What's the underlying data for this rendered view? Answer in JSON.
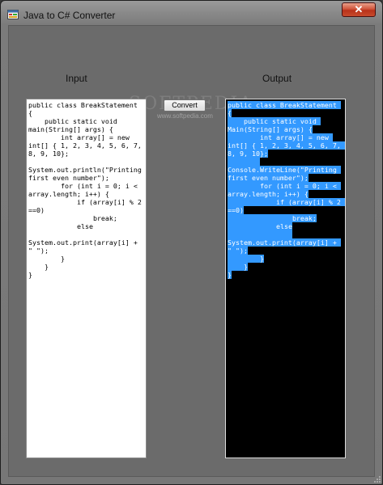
{
  "window": {
    "title": "Java to C# Converter",
    "close_glyph": "✕",
    "app_icon": "windows-form-icon"
  },
  "labels": {
    "input": "Input",
    "output": "Output"
  },
  "convert_button": "Convert",
  "watermark": {
    "text": "SOFTPEDIA",
    "url": "www.softpedia.com"
  },
  "input_code": [
    "public class BreakStatement {",
    "    public static void main(String[] args) {",
    "        int array[] = new int[] { 1, 2, 3, 4, 5, 6, 7, 8, 9, 10};",
    "        System.out.println(\"Printing first even number\");",
    "        for (int i = 0; i < array.length; i++) {",
    "            if (array[i] % 2 ==0)",
    "                break;",
    "            else",
    "                System.out.print(array[i] + \" \");",
    "        }",
    "    }",
    "}"
  ],
  "output_code": [
    "public class BreakStatement {",
    "    public static void Main(String[] args) {",
    "        int array[] = new int[] { 1, 2, 3, 4, 5, 6, 7, 8, 9, 10};",
    "        Console.WriteLine(\"Printing first even number\");",
    "        for (int i = 0; i < array.length; i++) {",
    "            if (array[i] % 2 ==0)",
    "                break;",
    "            else",
    "                System.out.print(array[i] + \" \");",
    "        }",
    "    }",
    "}"
  ],
  "colors": {
    "selection": "#3399ff",
    "output_bg": "#000000",
    "input_bg": "#ffffff"
  }
}
